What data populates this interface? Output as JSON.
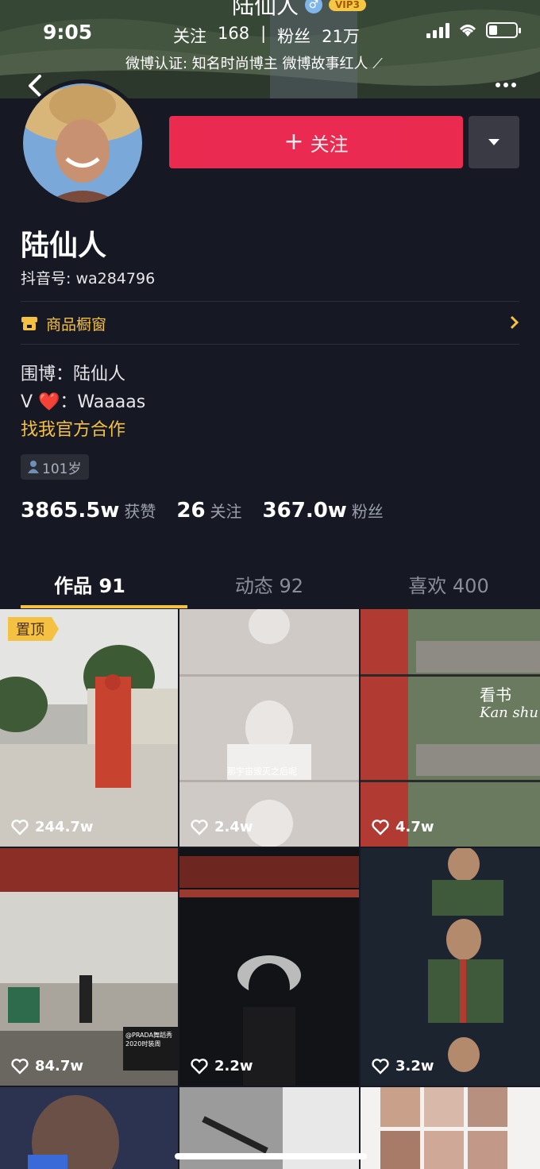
{
  "status_bar": {
    "time": "9:05"
  },
  "banner": {
    "name": "陆仙人",
    "gender_icon": "male-symbol-icon",
    "vip_label": "VIP3",
    "following_label": "关注",
    "following_count": "168",
    "separator": "|",
    "fans_label": "粉丝",
    "fans_count": "21万",
    "verification": "微博认证: 知名时尚博主 微博故事红人 ⟋"
  },
  "profile": {
    "follow_button": "关注",
    "name": "陆仙人",
    "douyin_id": "抖音号: wa284796",
    "shop_label": "商品橱窗",
    "bio_lines": [
      "围博：陆仙人",
      "V ❤️：Waaaas"
    ],
    "bio_link": "找我官方合作",
    "age_tag": "101岁",
    "stats": [
      {
        "num": "3865.5w",
        "label": "获赞"
      },
      {
        "num": "26",
        "label": "关注"
      },
      {
        "num": "367.0w",
        "label": "粉丝"
      }
    ]
  },
  "tabs": [
    {
      "label": "作品 91",
      "active": true
    },
    {
      "label": "动态 92",
      "active": false
    },
    {
      "label": "喜欢 400",
      "active": false
    }
  ],
  "grid": {
    "pinned_label": "置顶",
    "items": [
      {
        "likes": "244.7w"
      },
      {
        "likes": "2.4w",
        "overlay": "那宇宙毁灭之后呢"
      },
      {
        "likes": "4.7w",
        "overlay_cn": "看书",
        "overlay_en": "Kan shu"
      },
      {
        "likes": "84.7w",
        "overlay": "@PRADA舞蹈秀 2020时装周"
      },
      {
        "likes": "2.2w"
      },
      {
        "likes": "3.2w"
      },
      {
        "likes": ""
      },
      {
        "likes": ""
      },
      {
        "likes": ""
      }
    ]
  },
  "colors": {
    "accent_red": "#fe2c55",
    "accent_gold": "#f5c142",
    "background": "#161823"
  }
}
